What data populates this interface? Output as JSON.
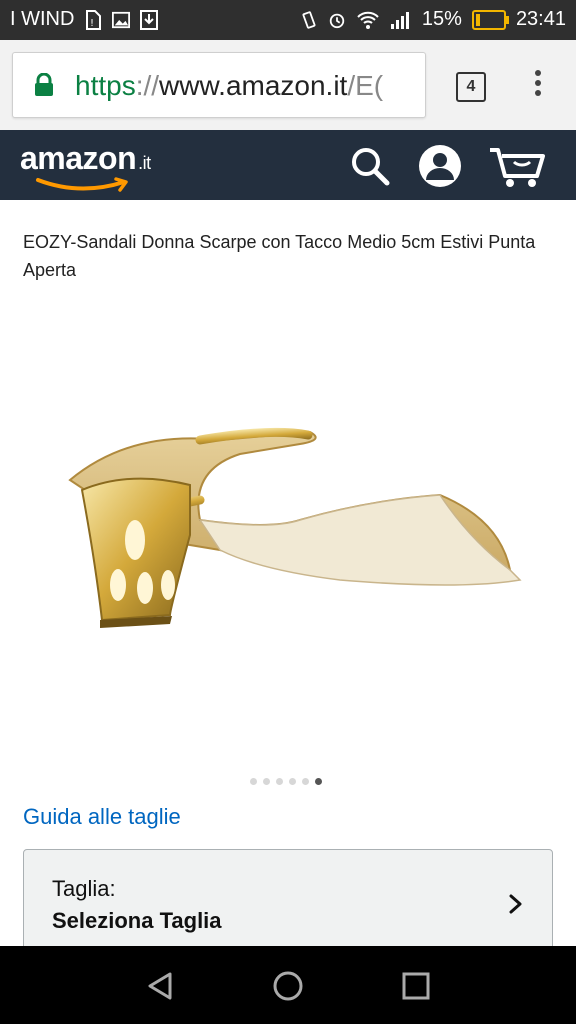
{
  "status_bar": {
    "carrier": "I WIND",
    "battery_percent": "15%",
    "battery_level": 0.15,
    "time": "23:41",
    "icons": [
      "sim-alert-icon",
      "image-icon",
      "download-icon",
      "vibrate-icon",
      "alarm-icon",
      "wifi-icon",
      "signal-icon",
      "battery-icon"
    ]
  },
  "browser": {
    "url_scheme": "https",
    "url_slashes": "://",
    "url_host": "www.amazon.it",
    "url_path": "/E(",
    "tab_count": "4"
  },
  "header": {
    "logo_text": "amazon",
    "logo_tld": ".it",
    "colors": {
      "background": "#232f3e",
      "smile": "#f90"
    }
  },
  "product": {
    "title": "EOZY-Sandali Donna Scarpe con Tacco Medio 5cm Estivi Punta Aperta",
    "image_count": 6,
    "active_image_index": 5
  },
  "size_guide_link": "Guida alle taglie",
  "size_selector": {
    "label": "Taglia:",
    "value": "Seleziona Taglia"
  },
  "nav_buttons": [
    "back-icon",
    "home-icon",
    "recents-icon"
  ]
}
